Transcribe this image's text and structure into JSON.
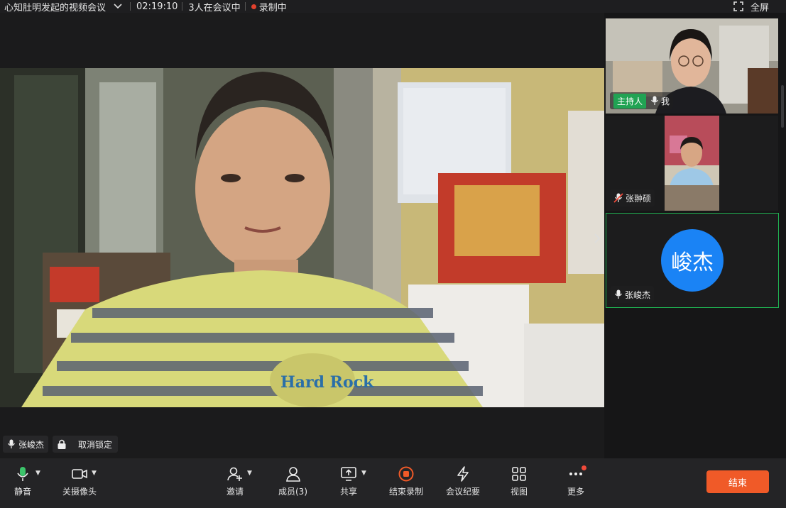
{
  "header": {
    "title": "心知肚明发起的视频会议",
    "duration": "02:19:10",
    "participants_text": "3人在会议中",
    "recording_text": "录制中",
    "fullscreen_label": "全屏"
  },
  "main": {
    "speaker_name": "张峻杰",
    "unlock_label": "取消锁定"
  },
  "side": {
    "tile1": {
      "host_label": "主持人",
      "name": "我"
    },
    "tile2": {
      "name": "张翀硕"
    },
    "tile3": {
      "name": "张峻杰",
      "avatar_text": "峻杰",
      "avatar_color": "#1a83f5"
    }
  },
  "toolbar": {
    "mute": "静音",
    "camera": "关摄像头",
    "invite": "邀请",
    "members": "成员(3)",
    "share": "共享",
    "stop_record": "结束录制",
    "minutes": "会议纪要",
    "view": "视图",
    "more": "更多",
    "end": "结束"
  },
  "colors": {
    "accent_green": "#21a353",
    "end_orange": "#f05a28",
    "record_red": "#e2412d",
    "active_border": "#1fb352"
  }
}
